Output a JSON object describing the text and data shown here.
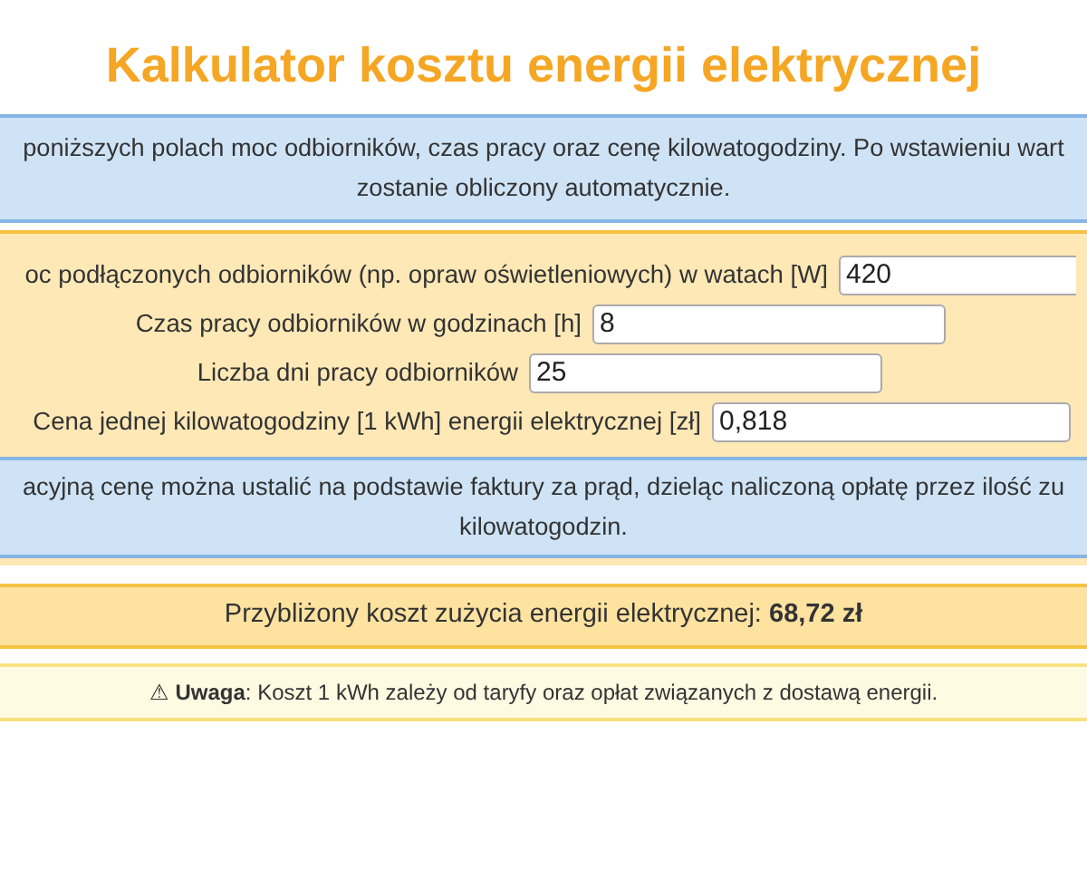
{
  "title": "Kalkulator kosztu energii elektrycznej",
  "intro": {
    "lines": [
      "poniższych polach moc odbiorników, czas pracy oraz cenę kilowatogodziny. Po wstawieniu wart",
      "zostanie obliczony automatycznie."
    ]
  },
  "fields": [
    {
      "label": "oc podłączonych odbiorników (np. opraw oświetleniowych) w watach [W]",
      "value": "420"
    },
    {
      "label": "Czas pracy odbiorników w godzinach [h]",
      "value": "8"
    },
    {
      "label": "Liczba dni pracy odbiorników",
      "value": "25"
    },
    {
      "label": "Cena jednej kilowatogodziny [1 kWh] energii elektrycznej [zł]",
      "value": "0,818"
    }
  ],
  "hint": {
    "lines": [
      "acyjną cenę można ustalić na podstawie faktury za prąd, dzieląc naliczoną opłatę przez ilość zu",
      "kilowatogodzin."
    ]
  },
  "result": {
    "text": "Przybliżony koszt zużycia energii elektrycznej: **68,72 zł**"
  },
  "warning": {
    "text": "⚠ **Uwaga**: Koszt 1 kWh zależy od taryfy oraz opłat związanych z dostawą energii."
  }
}
